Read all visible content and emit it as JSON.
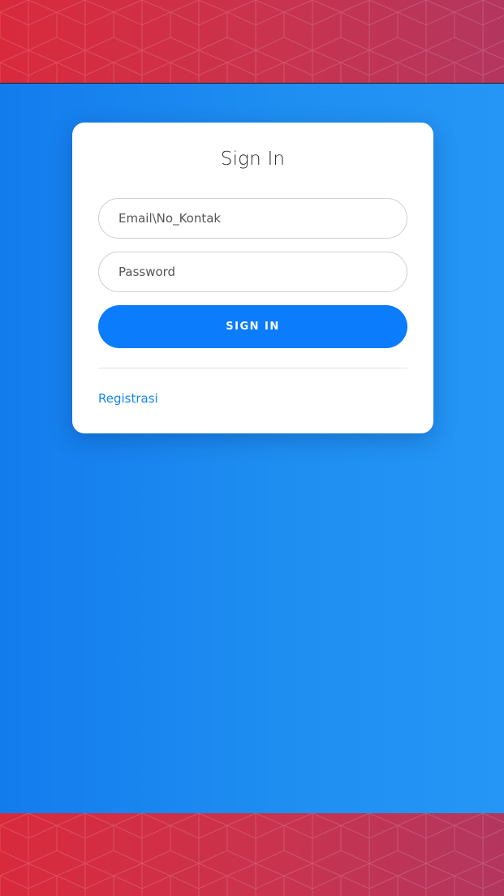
{
  "login": {
    "title": "Sign In",
    "email_placeholder": "Email\\No_Kontak",
    "password_placeholder": "Password",
    "signin_button": "SIGN IN",
    "register_link": "Registrasi"
  },
  "colors": {
    "band_start": "#d92a3c",
    "band_end": "#b3365f",
    "background_start": "#137ced",
    "background_end": "#2596f6",
    "button": "#0a7cfc",
    "link": "#1685f4"
  }
}
